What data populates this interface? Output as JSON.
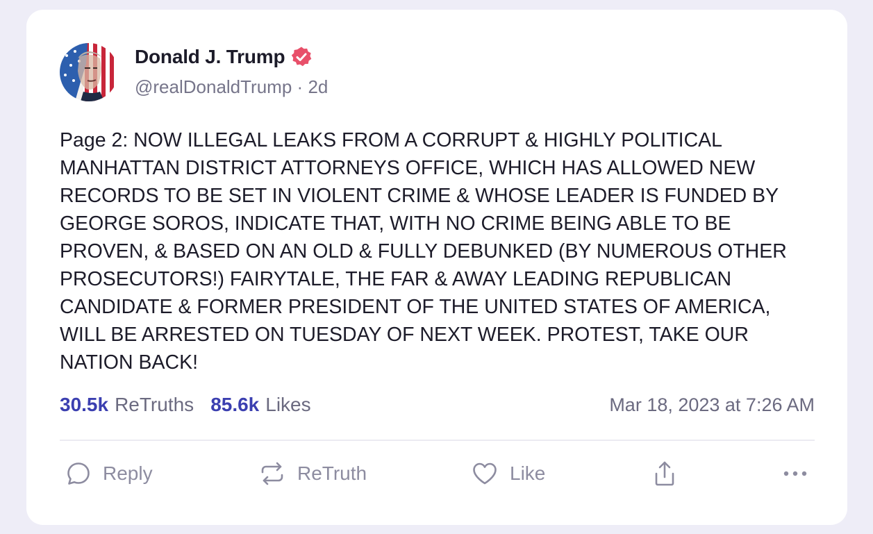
{
  "post": {
    "author": {
      "display_name": "Donald J. Trump",
      "handle": "@realDonaldTrump",
      "separator": "·",
      "relative_time": "2d",
      "verified_icon": "verified-badge-icon",
      "verified_color": "#e8506a"
    },
    "body": "Page 2: NOW ILLEGAL LEAKS FROM A CORRUPT & HIGHLY POLITICAL\nMANHATTAN DISTRICT ATTORNEYS OFFICE, WHICH HAS ALLOWED NEW\nRECORDS TO BE SET IN VIOLENT CRIME & WHOSE LEADER IS FUNDED BY\nGEORGE SOROS, INDICATE THAT, WITH NO CRIME BEING ABLE TO BE\nPROVEN, & BASED ON AN OLD & FULLY DEBUNKED (BY NUMEROUS OTHER\nPROSECUTORS!) FAIRYTALE, THE FAR & AWAY LEADING REPUBLICAN\nCANDIDATE & FORMER PRESIDENT OF THE UNITED STATES OF AMERICA,\nWILL BE ARRESTED ON TUESDAY OF NEXT WEEK. PROTEST, TAKE OUR\nNATION BACK!",
    "stats": {
      "retruths_count": "30.5k",
      "retruths_label": "ReTruths",
      "likes_count": "85.6k",
      "likes_label": "Likes",
      "timestamp": "Mar 18, 2023 at 7:26 AM"
    },
    "actions": {
      "reply_label": "Reply",
      "retruth_label": "ReTruth",
      "like_label": "Like",
      "share_icon": "share-icon",
      "more_icon": "more-icon"
    }
  },
  "colors": {
    "page_background": "#eeedf7",
    "card_background": "#ffffff",
    "accent": "#3b3fb0",
    "muted_text": "#76758a",
    "verified": "#e8506a"
  }
}
